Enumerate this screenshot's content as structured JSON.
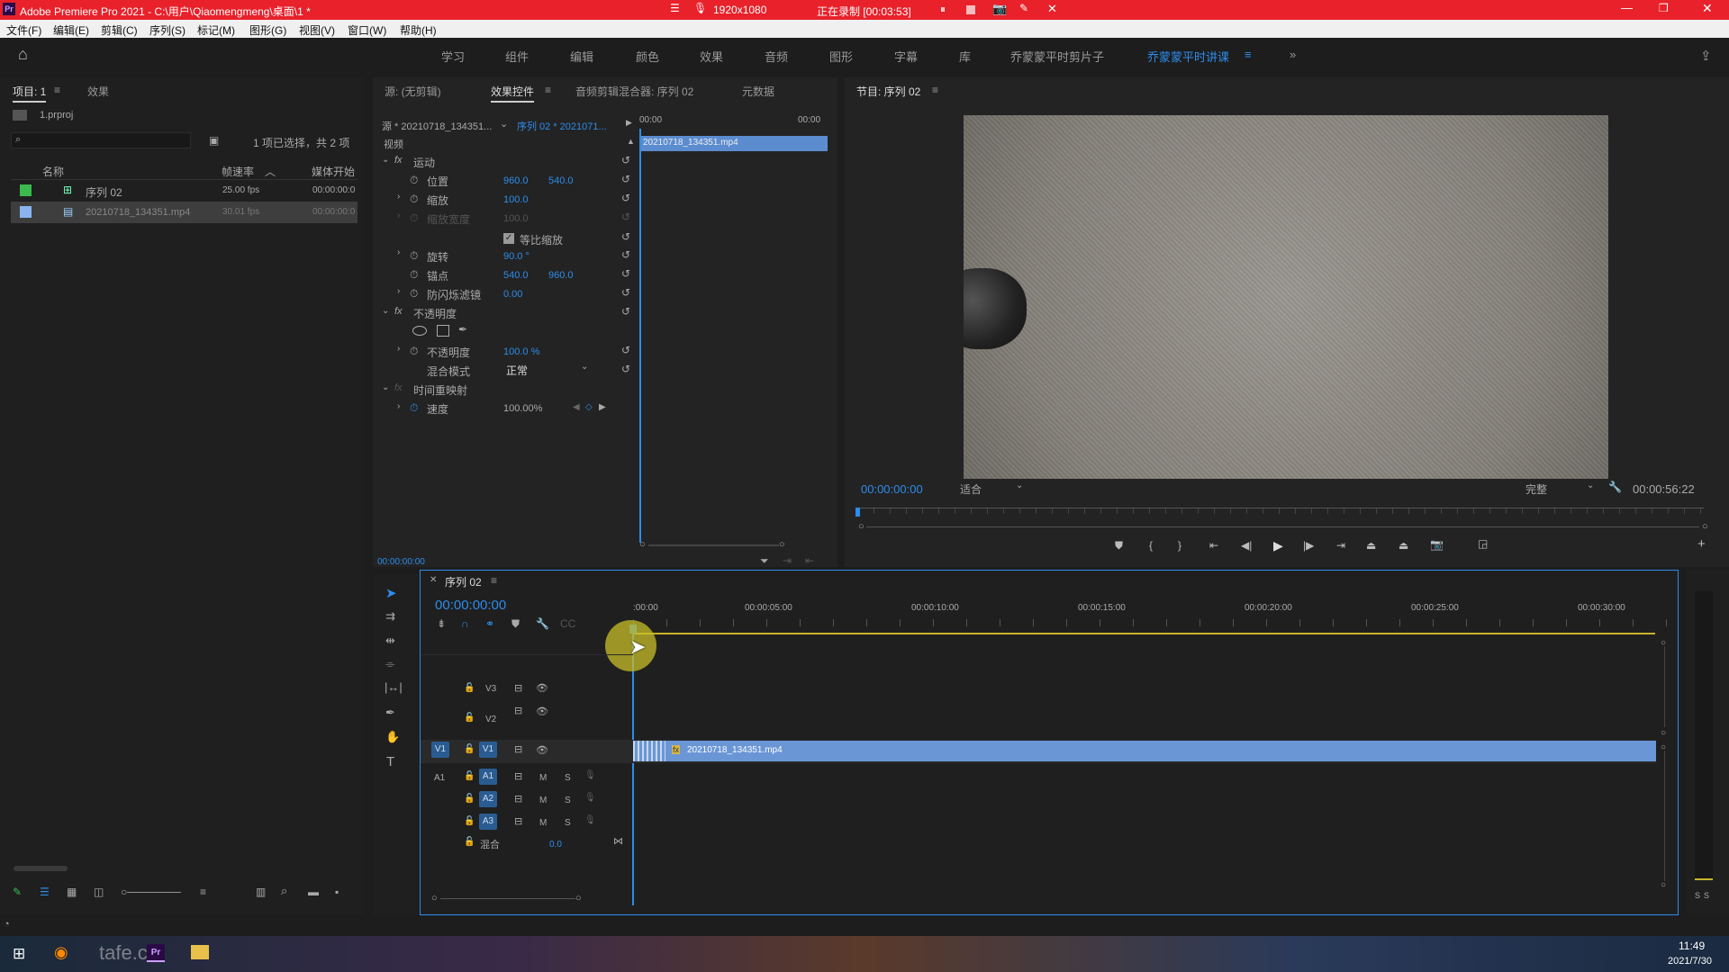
{
  "recording": {
    "resolution": "1920x1080",
    "status": "正在录制 [00:03:53]"
  },
  "app_title": "Adobe Premiere Pro 2021 - C:\\用户\\Qiaomengmeng\\桌面\\1 *",
  "menu": [
    "文件(F)",
    "编辑(E)",
    "剪辑(C)",
    "序列(S)",
    "标记(M)",
    "图形(G)",
    "视图(V)",
    "窗口(W)",
    "帮助(H)"
  ],
  "workspaces": [
    "学习",
    "组件",
    "编辑",
    "颜色",
    "效果",
    "音频",
    "图形",
    "字幕",
    "库",
    "乔蒙蒙平时剪片子",
    "乔蒙蒙平时讲课"
  ],
  "project": {
    "tab": "项目: 1",
    "tab2": "效果",
    "file": "1.prproj",
    "selection": "1 项已选择，共 2 项",
    "col_name": "名称",
    "col_fps": "帧速率",
    "col_start": "媒体开始",
    "items": [
      {
        "name": "序列 02",
        "fps": "25.00 fps",
        "start": "00:00:00:0"
      },
      {
        "name": "20210718_134351.mp4",
        "fps": "30.01 fps",
        "start": "00:00:00:0"
      }
    ]
  },
  "effects": {
    "tabs": [
      "源: (无剪辑)",
      "效果控件",
      "音频剪辑混合器: 序列 02",
      "元数据"
    ],
    "source": "源 * 20210718_134351...",
    "seq": "序列 02 * 2021071...",
    "t0": "00:00",
    "t1": "00:00",
    "clip": "20210718_134351.mp4",
    "video": "视频",
    "motion": "运动",
    "position": "位置",
    "pos_x": "960.0",
    "pos_y": "540.0",
    "scale": "缩放",
    "scale_v": "100.0",
    "scale_w": "缩放宽度",
    "scale_w_v": "100.0",
    "uniform": "等比缩放",
    "rotation": "旋转",
    "rot_v": "90.0 °",
    "anchor": "锚点",
    "anc_x": "540.0",
    "anc_y": "960.0",
    "flicker": "防闪烁滤镜",
    "flicker_v": "0.00",
    "opacity_h": "不透明度",
    "opacity": "不透明度",
    "opacity_v": "100.0 %",
    "blend": "混合模式",
    "blend_v": "正常",
    "remap": "时间重映射",
    "speed": "速度",
    "speed_v": "100.00%",
    "timecode": "00:00:00:00"
  },
  "program": {
    "tab": "节目: 序列 02",
    "timecode": "00:00:00:00",
    "fit": "适合",
    "quality": "完整",
    "duration": "00:00:56:22"
  },
  "timeline": {
    "tab": "序列 02",
    "timecode": "00:00:00:00",
    "ticks": [
      ":00:00",
      "00:00:05:00",
      "00:00:10:00",
      "00:00:15:00",
      "00:00:20:00",
      "00:00:25:00",
      "00:00:30:00"
    ],
    "tracks": {
      "v3": "V3",
      "v2": "V2",
      "v1": "V1",
      "a1": "A1",
      "a2": "A2",
      "a3": "A3",
      "mix": "混合",
      "mix_v": "0.0",
      "m": "M",
      "s": "S"
    },
    "clip": "20210718_134351.mp4"
  },
  "meter": {
    "s1": "S",
    "s2": "S"
  },
  "taskbar": {
    "time": "11:49",
    "date": "2021/7/30",
    "watermark": "tafe.cc"
  }
}
